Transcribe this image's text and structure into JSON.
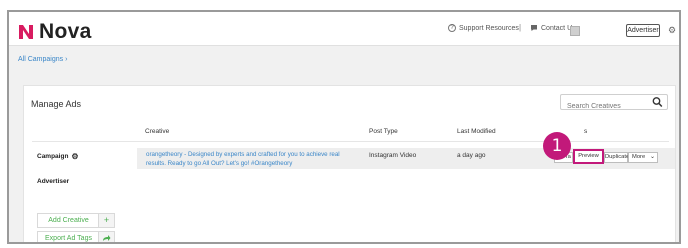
{
  "header": {
    "logo_text": "Nova",
    "support_label": "Support Resources",
    "separator": "|",
    "contact_label": "Contact Us",
    "advertiser_button": "Advertiser"
  },
  "breadcrumb": {
    "label": "All Campaigns ›"
  },
  "panel": {
    "title": "Manage Ads",
    "search_placeholder": "Search Creatives",
    "columns": {
      "creative": "Creative",
      "post_type": "Post Type",
      "last_modified": "Last Modified",
      "actions": "s"
    },
    "campaign_label": "Campaign",
    "advertiser_label": "Advertiser",
    "row": {
      "creative_text": "orangetheory - Designed by experts and crafted for you to achieve real results. Ready to go All Out? Let's go! #Orangetheory",
      "post_type": "Instagram Video",
      "last_modified": "a day ago",
      "buttons": {
        "ad_tag": "Ad Ta",
        "preview": "Preview",
        "duplicate": "Duplicate",
        "more": "More"
      }
    },
    "add_creative": "Add Creative",
    "export_ad_tags": "Export Ad Tags"
  },
  "annotation": {
    "step": "1",
    "color": "#c2197a"
  },
  "colors": {
    "link": "#3a86c8",
    "green": "#4caf50",
    "logo_mark": "#d81b60"
  }
}
